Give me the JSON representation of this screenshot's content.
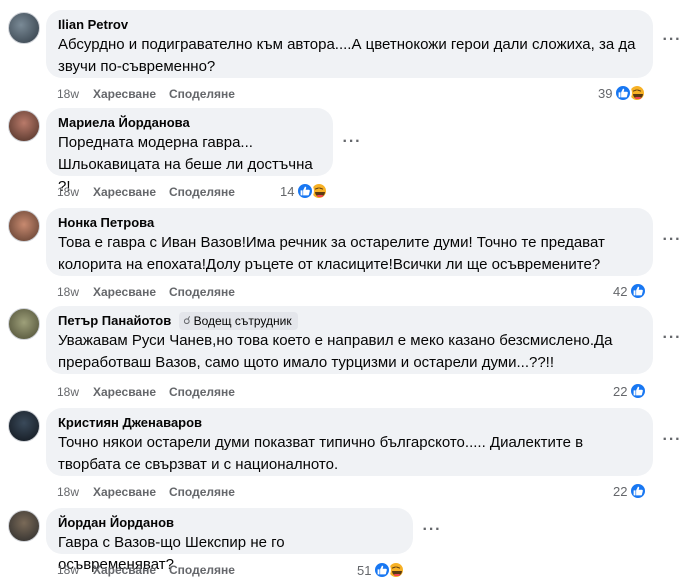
{
  "comments": [
    {
      "author": "Ilian Petrov",
      "badge": "",
      "lines": [
        "Абсурдно и подигравателно към автора....А цветнокожи герои дали сложиха, за да",
        "звучи по-съвременно?"
      ],
      "time": "18w",
      "like_label": "Харесване",
      "share_label": "Споделяне",
      "reaction_count": "39",
      "reactions": [
        "like",
        "haha"
      ],
      "avatar_colors": [
        "#7a8a96",
        "#2f3a44"
      ]
    },
    {
      "author": "Мариела Йорданова",
      "badge": "",
      "lines": [
        "Поредната модерна гавра...",
        "Шльокавицата на беше ли достъчна ?!"
      ],
      "time": "18w",
      "like_label": "Харесване",
      "share_label": "Споделяне",
      "reaction_count": "14",
      "reactions": [
        "like",
        "haha"
      ],
      "avatar_colors": [
        "#b97a6a",
        "#4a2e24"
      ]
    },
    {
      "author": "Нонка Петрова",
      "badge": "",
      "lines": [
        "Това е гавра с Иван Вазов!Има речник за остарелите думи! Точно те предават",
        "колорита на епохата!Долу ръцете от класиците!Всички ли ще осъвремените?"
      ],
      "time": "18w",
      "like_label": "Харесване",
      "share_label": "Споделяне",
      "reaction_count": "42",
      "reactions": [
        "like"
      ],
      "avatar_colors": [
        "#c88a70",
        "#5a3a2c"
      ]
    },
    {
      "author": "Петър Панайотов",
      "badge": "Водещ сътрудник",
      "lines": [
        "Уважавам Руси Чанев,но това което е направил е меко казано безсмислено.Да",
        "преработваш Вазов, само щото имало турцизми и остарели думи...??!!"
      ],
      "time": "18w",
      "like_label": "Харесване",
      "share_label": "Споделяне",
      "reaction_count": "22",
      "reactions": [
        "like"
      ],
      "avatar_colors": [
        "#9ea07a",
        "#4a4a32"
      ]
    },
    {
      "author": "Кристиян Дженаваров",
      "badge": "",
      "lines": [
        "Точно някои остарели думи показват типично българското..... Диалектите в",
        "творбата се свързват и с националното."
      ],
      "time": "18w",
      "like_label": "Харесване",
      "share_label": "Споделяне",
      "reaction_count": "22",
      "reactions": [
        "like"
      ],
      "avatar_colors": [
        "#3a4a5a",
        "#10151c"
      ]
    },
    {
      "author": "Йордан Йорданов",
      "badge": "",
      "lines": [
        "Гавра с Вазов-що Шекспир не го осъвременяват?"
      ],
      "time": "18w",
      "like_label": "Харесване",
      "share_label": "Споделяне",
      "reaction_count": "51",
      "reactions": [
        "like",
        "haha"
      ],
      "avatar_colors": [
        "#7a6a58",
        "#2a2a2a"
      ]
    }
  ],
  "icons": {
    "more": "more-options-icon",
    "like": "like-reaction-icon",
    "haha": "haha-reaction-icon",
    "badge": "badge-icon"
  }
}
